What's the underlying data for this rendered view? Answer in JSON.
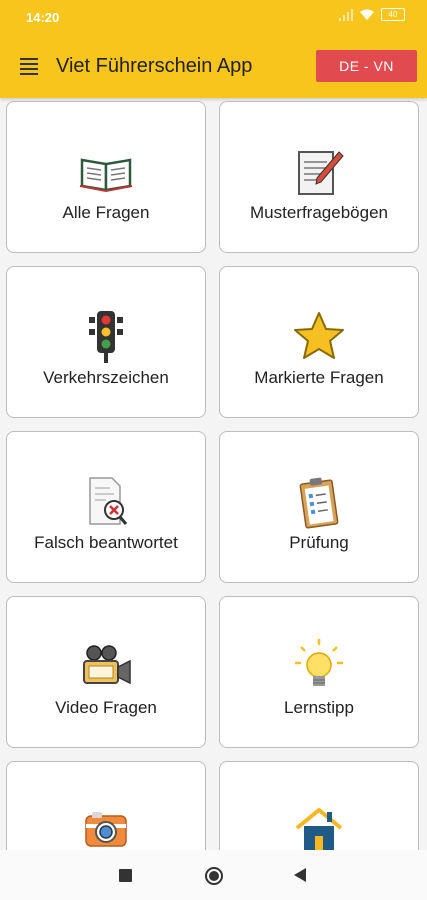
{
  "status": {
    "time": "14:20",
    "battery": "40"
  },
  "appbar": {
    "title": "Viet Führerschein App",
    "lang_button": "DE - VN"
  },
  "menu": [
    {
      "label": "Alle Fragen",
      "icon": "book-icon"
    },
    {
      "label": "Musterfragebögen",
      "icon": "notepad-pencil-icon"
    },
    {
      "label": "Verkehrszeichen",
      "icon": "traffic-light-icon"
    },
    {
      "label": "Markierte Fragen",
      "icon": "star-icon"
    },
    {
      "label": "Falsch beantwortet",
      "icon": "wrong-document-icon"
    },
    {
      "label": "Prüfung",
      "icon": "clipboard-checklist-icon"
    },
    {
      "label": "Video Fragen",
      "icon": "video-camera-icon"
    },
    {
      "label": "Lernstipp",
      "icon": "lightbulb-icon"
    },
    {
      "label": "",
      "icon": "photo-camera-icon"
    },
    {
      "label": "",
      "icon": "home-icon"
    }
  ]
}
